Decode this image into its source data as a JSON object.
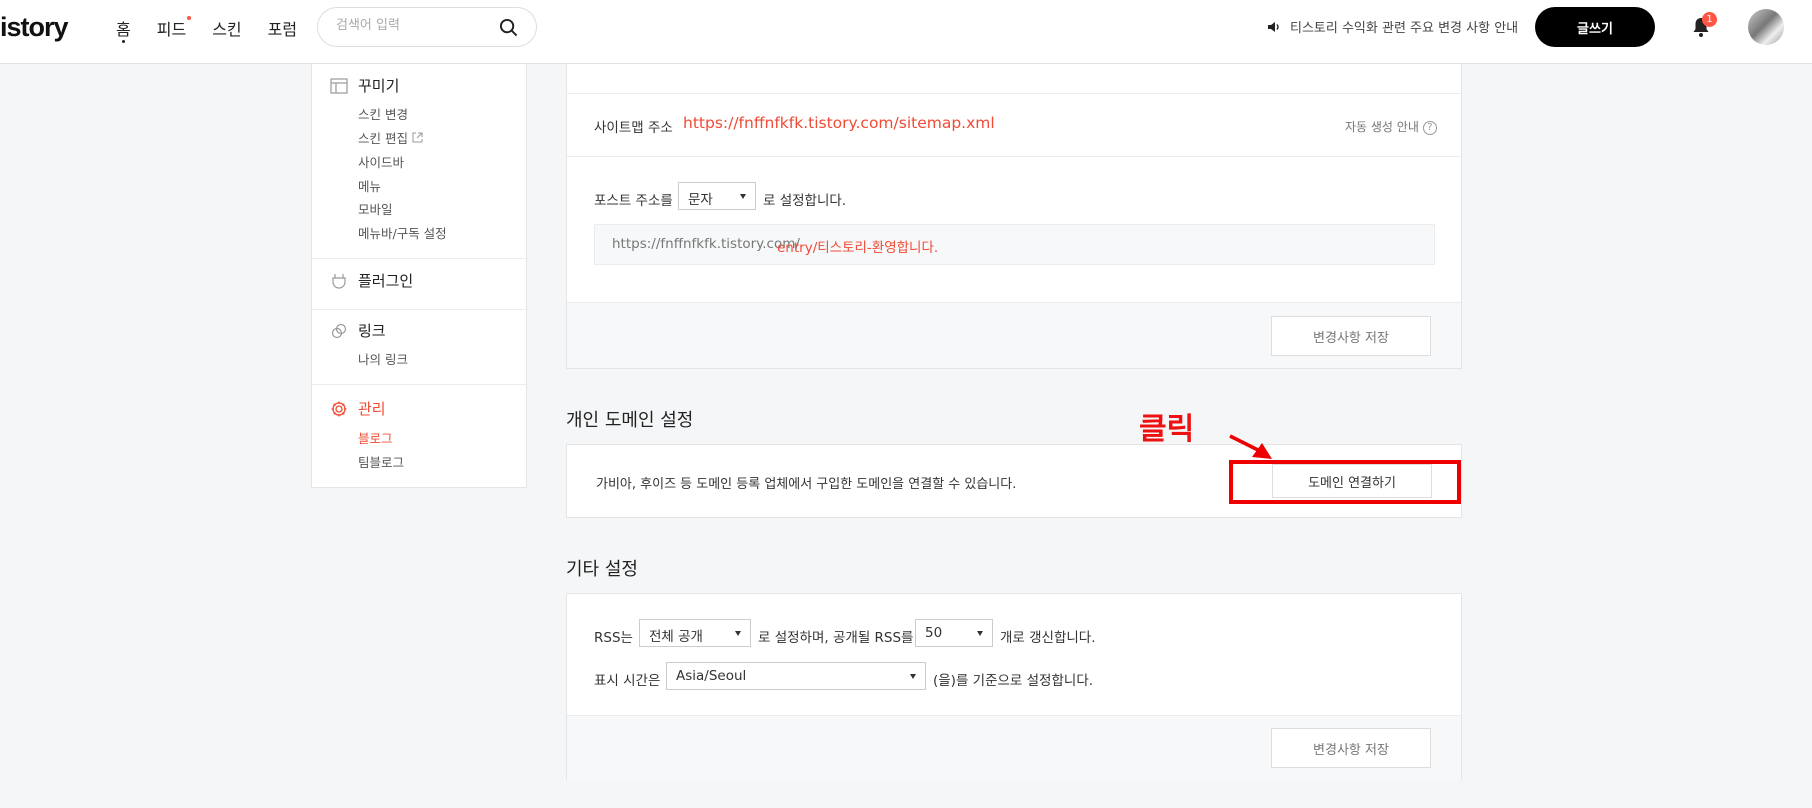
{
  "header": {
    "logo": "istory",
    "nav": [
      "홈",
      "피드",
      "스킨",
      "포럼"
    ],
    "search_placeholder": "검색어 입력",
    "notice": "티스토리 수익화 관련 주요 변경 사항 안내",
    "write_button": "글쓰기",
    "notification_count": "1"
  },
  "sidebar": {
    "decorate": {
      "title": "꾸미기",
      "items": [
        "스킨 변경",
        "스킨 편집",
        "사이드바",
        "메뉴",
        "모바일",
        "메뉴바/구독 설정"
      ]
    },
    "plugin": {
      "title": "플러그인"
    },
    "link": {
      "title": "링크",
      "items": [
        "나의 링크"
      ]
    },
    "manage": {
      "title": "관리",
      "items": [
        "블로그",
        "팀블로그"
      ]
    }
  },
  "address_panel": {
    "sitemap_label": "사이트맵 주소",
    "sitemap_url": "https://fnffnfkfk.tistory.com/sitemap.xml",
    "auto_gen": "자동 생성 안내",
    "post_label": "포스트 주소를",
    "post_select": "문자",
    "post_suffix": "로 설정합니다.",
    "preview_base": "https://fnffnfkfk.tistory.com/",
    "preview_path": "entry/티스토리-환영합니다.",
    "save": "변경사항 저장"
  },
  "domain_section": {
    "title": "개인 도메인 설정",
    "description": "가비아, 후이즈 등 도메인 등록 업체에서 구입한 도메인을 연결할 수 있습니다.",
    "connect_button": "도메인 연결하기"
  },
  "other_section": {
    "title": "기타 설정",
    "rss_prefix": "RSS는",
    "rss_select": "전체 공개",
    "rss_middle": "로 설정하며, 공개될 RSS를",
    "rss_count": "50",
    "rss_suffix": "개로 갱신합니다.",
    "time_prefix": "표시 시간은",
    "time_select": "Asia/Seoul",
    "time_suffix": "(을)를 기준으로 설정합니다.",
    "save": "변경사항 저장"
  },
  "annotation": {
    "label": "클릭"
  },
  "colors": {
    "accent": "#f04b35",
    "annotation": "#ee0000"
  }
}
